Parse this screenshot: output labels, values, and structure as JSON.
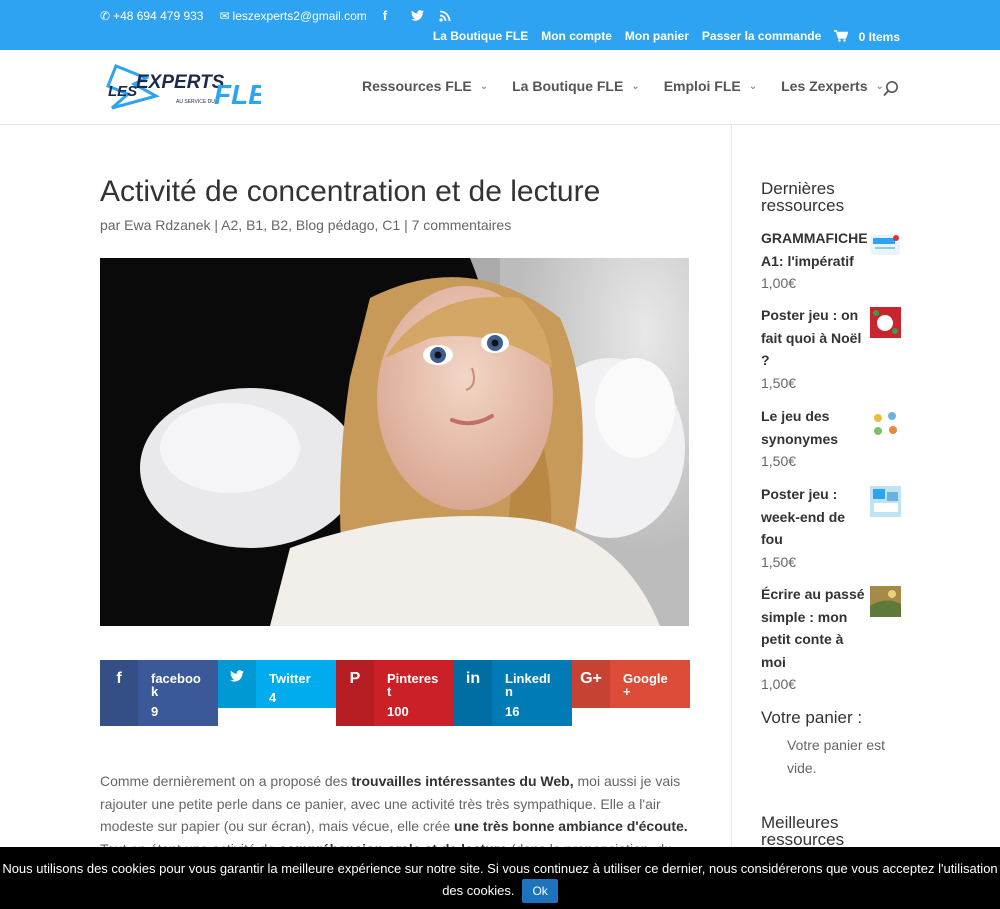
{
  "topbar": {
    "phone": "+48 694 479 933",
    "email": "leszexperts2@gmail.com",
    "social": [
      "facebook-icon",
      "twitter-icon",
      "rss-icon"
    ],
    "links": [
      "La Boutique FLE",
      "Mon compte",
      "Mon panier",
      "Passer la commande"
    ],
    "cart_label": "0 Items"
  },
  "header": {
    "logo_text_1": "LES",
    "logo_text_2": "EXPERTS",
    "logo_text_3": "FLE",
    "logo_tagline": "AU SERVICE DU",
    "nav": [
      "Ressources FLE",
      "La Boutique FLE",
      "Emploi FLE",
      "Les Zexperts"
    ]
  },
  "post": {
    "title": "Activité de concentration et de lecture",
    "meta_prefix": "par",
    "author": "Ewa Rdzanek",
    "sep": "|",
    "categories": "A2, B1, B2, Blog pédago, C1",
    "comments": "7 commentaires"
  },
  "share": [
    {
      "label": "facebook",
      "count": "9",
      "color": "#3b5998",
      "icon": "f"
    },
    {
      "label": "Twitter",
      "count": "4",
      "color": "#00aced",
      "icon": "🐦"
    },
    {
      "label": "Pinterest",
      "count": "100",
      "color": "#cb2027",
      "icon": "P"
    },
    {
      "label": "LinkedIn",
      "count": "16",
      "color": "#007bb6",
      "icon": "in"
    },
    {
      "label": "Google+",
      "count": "",
      "color": "#dd4b39",
      "icon": "G+"
    }
  ],
  "body": {
    "p1_a": "Comme dernièrement on a proposé des ",
    "p1_b": "trouvailles intéressantes du Web,",
    "p1_c": " moi aussi je vais rajouter une petite perle dans ce panier, avec une activité très très sympathique. Elle a l'air modeste sur papier (ou sur écran), mais vécue, elle crée ",
    "p1_d": "une très bonne ambiance d'écoute.",
    "p1_e": " Tout en étant une activité de ",
    "p1_f": "compréhension orale et de lecture",
    "p1_g": " (dans la prononciation, du"
  },
  "sidebar": {
    "recent_title": "Dernières ressources",
    "products": [
      {
        "name": "GRAMMAFICHE A1: l'impératif",
        "price": "1,00€"
      },
      {
        "name": "Poster jeu : on fait quoi à Noël ?",
        "price": "1,50€"
      },
      {
        "name": "Le jeu des synonymes",
        "price": "1,50€"
      },
      {
        "name": "Poster jeu : week-end de fou",
        "price": "1,50€"
      },
      {
        "name": "Écrire au passé simple : mon petit conte à moi",
        "price": "1,00€"
      }
    ],
    "cart_title": "Votre panier :",
    "cart_empty": "Votre panier est vide.",
    "best_title": "Meilleures ressources"
  },
  "cookie": {
    "text": "Nous utilisons des cookies pour vous garantir la meilleure expérience sur notre site. Si vous continuez à utiliser ce dernier, nous considérerons que vous acceptez l'utilisation des cookies.",
    "ok": "Ok"
  }
}
